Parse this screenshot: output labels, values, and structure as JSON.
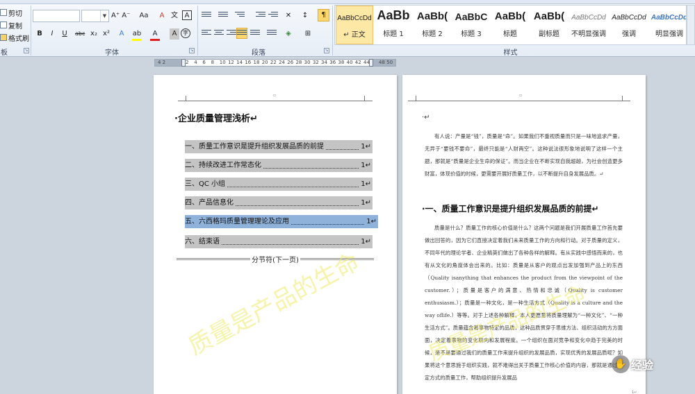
{
  "ribbon": {
    "clipboard": {
      "cut": "剪切",
      "copy": "复制",
      "format_painter": "格式刷",
      "group_label": "板"
    },
    "font_group": {
      "label": "字体",
      "grow_shrink": "A⁺ A⁻",
      "change_case": "Aa",
      "clear_format": "A",
      "pinyin": "文",
      "char_border": "A",
      "bold": "B",
      "italic": "I",
      "underline": "U",
      "strike": "abc",
      "subscript": "x₂",
      "superscript": "x²",
      "effects": "A",
      "highlight": "ab",
      "font_color": "A",
      "char_shading": "A",
      "enclose": "字"
    },
    "paragraph_group": {
      "label": "段落"
    },
    "styles_group": {
      "label": "样式",
      "items": [
        {
          "sample": "AaBbCcDd",
          "name": "↵ 正文"
        },
        {
          "sample": "AaBb",
          "name": "标题 1"
        },
        {
          "sample": "AaBb(",
          "name": "标题 2"
        },
        {
          "sample": "AaBbC",
          "name": "标题 3"
        },
        {
          "sample": "AaBb(",
          "name": "标题"
        },
        {
          "sample": "AaBb(",
          "name": "副标题"
        },
        {
          "sample": "AaBbCcDd",
          "name": "不明显强调"
        },
        {
          "sample": "AaBbCcDd",
          "name": "强调"
        },
        {
          "sample": "AaBbCcDd",
          "name": "明显强调"
        }
      ]
    }
  },
  "ruler": {
    "left_grey": "4 2",
    "ticks": [
      "2",
      "4",
      "6",
      "8",
      "10",
      "12",
      "14",
      "16",
      "18",
      "20",
      "22",
      "24",
      "26",
      "28",
      "30",
      "32",
      "34",
      "36",
      "38",
      "40",
      "42",
      "44"
    ],
    "right_grey": "48 50"
  },
  "page1": {
    "top_mark": "▫",
    "title": "·企业质量管理浅析↵",
    "toc": [
      {
        "label": "一、质量工作意识是提升组织发展品质的前提",
        "page": "1↵"
      },
      {
        "label": "二、持续改进工作常态化",
        "page": "1↵"
      },
      {
        "label": "三、QC 小组",
        "page": "1↵"
      },
      {
        "label": "四、产品信息化",
        "page": "1↵"
      },
      {
        "label": "五、六西格玛质量管理理论及应用",
        "page": "1↵"
      },
      {
        "label": "六、结束语",
        "page": "1↵"
      }
    ],
    "section_break": "分节符(下一页)",
    "watermark": "质量是产品的生命"
  },
  "page2": {
    "top_mark": "▫",
    "bullet": "·↵",
    "intro": "有人说：产量是“钱”，质量是“命”。如果我们不重视质量而只是一味地追求产量，无异于“要钱不要命”，最终只能是“人财两空”。这种说法很形象地说明了这样一个主题，那就是“质量是企业生命的保证”。而当企业在不断实现自我超越，为社会创造更多财富，体现价值的时候，更需要开展好质量工作，以不断提升自身发展品质。↵",
    "heading": "·一、质量工作意识是提升组织发展品质的前提↵",
    "body": "质量是什么？质量工作的核心价值是什么？这两个问题是我们开展质量工作首先要做出回答的，因为它们直接决定着我们未来质量工作的方向和行动。对于质量的定义，不同年代的理论学者、企业精英们做出了各种各样的解释。有从实践中感悟而来的，也有从文化的角度体会出来的。比如：质量是从客户的观点出发加强到产品上的东西（Quality isanything that enhances the product from the viewpoint of the customer.）；质量是客户的满意、热情和忠诚（Quality is customer enthusiasm.）；质量是一种文化，是一种生活方式（Quality is a culture and the way oflife.）等等。对于上述各种解释，本人更愿意将质量理解为“一种文化”、“一种生活方式”。质量蕴含着事物特定的品质，这种品质贯穿于思维方法、组织活动的方方面面，决定着事物的变化取向和发展程度。一个组织在面对竞争和变化中趋于完美的时候，是不是要通过我们的质量工作来提升组织的发展品质，实现优秀的发展品质呢？如果将这个意思施于组织实践，就不难得出关于质量工作核心价值的内容，那就是通过一定方式的质量工作，帮助组织提升发展品",
    "watermark": "质量是产品的生命",
    "page_mark": "1↵"
  },
  "badge": {
    "text": "经验"
  },
  "colors": {
    "ribbon_bg": "#e6edf6",
    "doc_bg": "#ccd4de",
    "toc_highlight": "#c4c4c4",
    "toc_selected": "#8fb2db",
    "watermark": "#eee85a",
    "style_selected": "#fde8a6"
  }
}
